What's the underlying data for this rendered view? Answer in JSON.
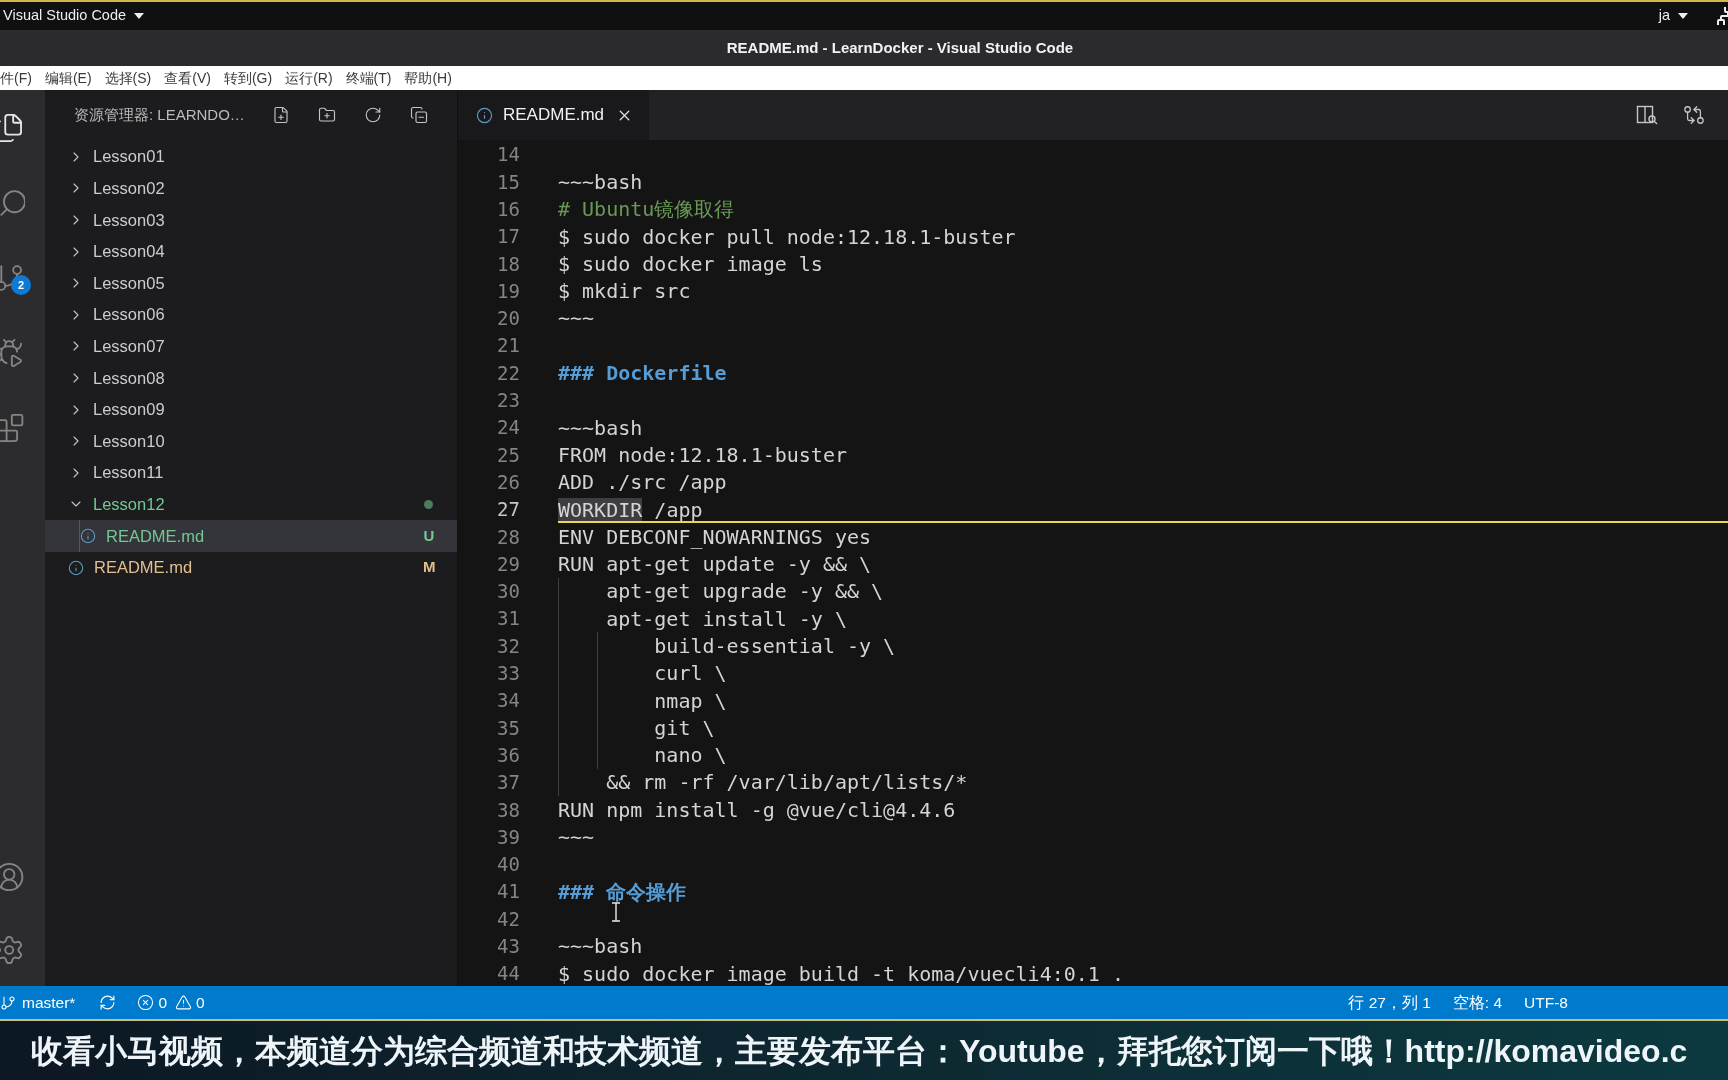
{
  "top_bar": {
    "app_menu": "Visual Studio Code",
    "input_source": "ja"
  },
  "title_bar": {
    "title": "README.md - LearnDocker - Visual Studio Code"
  },
  "menu_bar": {
    "items": [
      "件(F)",
      "编辑(E)",
      "选择(S)",
      "查看(V)",
      "转到(G)",
      "运行(R)",
      "终端(T)",
      "帮助(H)"
    ]
  },
  "activity_bar": {
    "items": [
      {
        "kind": "explorer",
        "selected": true
      },
      {
        "kind": "search",
        "selected": false
      },
      {
        "kind": "source_control",
        "selected": false,
        "badge": "2"
      },
      {
        "kind": "run_debug",
        "selected": false
      },
      {
        "kind": "extensions",
        "selected": false
      }
    ],
    "bottom_items": [
      {
        "kind": "account"
      },
      {
        "kind": "settings"
      }
    ]
  },
  "sidebar": {
    "title": "资源管理器: LEARNDO…",
    "items": [
      {
        "label": "Lesson01",
        "kind": "folder",
        "expanded": false,
        "selected": false
      },
      {
        "label": "Lesson02",
        "kind": "folder",
        "expanded": false,
        "selected": false
      },
      {
        "label": "Lesson03",
        "kind": "folder",
        "expanded": false,
        "selected": false
      },
      {
        "label": "Lesson04",
        "kind": "folder",
        "expanded": false,
        "selected": false
      },
      {
        "label": "Lesson05",
        "kind": "folder",
        "expanded": false,
        "selected": false
      },
      {
        "label": "Lesson06",
        "kind": "folder",
        "expanded": false,
        "selected": false
      },
      {
        "label": "Lesson07",
        "kind": "folder",
        "expanded": false,
        "selected": false
      },
      {
        "label": "Lesson08",
        "kind": "folder",
        "expanded": false,
        "selected": false
      },
      {
        "label": "Lesson09",
        "kind": "folder",
        "expanded": false,
        "selected": false
      },
      {
        "label": "Lesson10",
        "kind": "folder",
        "expanded": false,
        "selected": false
      },
      {
        "label": "Lesson11",
        "kind": "folder",
        "expanded": false,
        "selected": false
      },
      {
        "label": "Lesson12",
        "kind": "folder",
        "expanded": true,
        "selected": false,
        "color": "#73c991",
        "children": [
          {
            "label": "README.md",
            "kind": "file",
            "selected": true,
            "color": "#73c991",
            "badge": "U"
          }
        ]
      },
      {
        "label": "README.md",
        "kind": "file",
        "selected": false,
        "color": "#e2c08d",
        "badge": "M"
      }
    ]
  },
  "editor": {
    "tabs": [
      {
        "label": "README.md",
        "selected": true
      }
    ],
    "lines": [
      {
        "number": "14",
        "current": false
      },
      {
        "number": "15",
        "kind": "code",
        "current": false,
        "tokens": [
          {
            "text": "~~~bash",
            "highlighted": false
          }
        ]
      },
      {
        "number": "16",
        "kind": "comment",
        "current": false,
        "tokens": [
          {
            "text": "# Ubuntu镜像取得",
            "highlighted": false
          }
        ]
      },
      {
        "number": "17",
        "kind": "code",
        "current": false,
        "tokens": [
          {
            "text": "$ sudo docker pull node:12.18.1-buster",
            "highlighted": false
          }
        ]
      },
      {
        "number": "18",
        "kind": "code",
        "current": false,
        "tokens": [
          {
            "text": "$ sudo docker image ls",
            "highlighted": false
          }
        ]
      },
      {
        "number": "19",
        "kind": "code",
        "current": false,
        "tokens": [
          {
            "text": "$ mkdir src",
            "highlighted": false
          }
        ]
      },
      {
        "number": "20",
        "kind": "code",
        "current": false,
        "tokens": [
          {
            "text": "~~~",
            "highlighted": false
          }
        ]
      },
      {
        "number": "21",
        "current": false
      },
      {
        "number": "22",
        "kind": "heading",
        "current": false,
        "tokens": [
          {
            "text": "### Dockerfile",
            "highlighted": false
          }
        ]
      },
      {
        "number": "23",
        "current": false
      },
      {
        "number": "24",
        "kind": "code",
        "current": false,
        "tokens": [
          {
            "text": "~~~bash",
            "highlighted": false
          }
        ]
      },
      {
        "number": "25",
        "kind": "code",
        "current": false,
        "tokens": [
          {
            "text": "FROM node:12.18.1-buster",
            "highlighted": false
          }
        ]
      },
      {
        "number": "26",
        "kind": "code",
        "current": false,
        "tokens": [
          {
            "text": "ADD ./src /app",
            "highlighted": false
          }
        ]
      },
      {
        "number": "27",
        "kind": "code",
        "current": true,
        "tokens": [
          {
            "text": "WORKDIR",
            "highlighted": true
          },
          {
            "text": " /app",
            "highlighted": false
          }
        ]
      },
      {
        "number": "28",
        "kind": "code",
        "current": false,
        "tokens": [
          {
            "text": "ENV DEBCONF_NOWARNINGS yes",
            "highlighted": false
          }
        ]
      },
      {
        "number": "29",
        "kind": "code",
        "current": false,
        "tokens": [
          {
            "text": "RUN apt-get update -y && \\",
            "highlighted": false
          }
        ]
      },
      {
        "number": "30",
        "kind": "code",
        "current": false,
        "tokens": [
          {
            "text": "    apt-get upgrade -y && \\",
            "highlighted": false
          }
        ]
      },
      {
        "number": "31",
        "kind": "code",
        "current": false,
        "tokens": [
          {
            "text": "    apt-get install -y \\",
            "highlighted": false
          }
        ]
      },
      {
        "number": "32",
        "kind": "code",
        "current": false,
        "tokens": [
          {
            "text": "        build-essential -y \\",
            "highlighted": false
          }
        ]
      },
      {
        "number": "33",
        "kind": "code",
        "current": false,
        "tokens": [
          {
            "text": "        curl \\",
            "highlighted": false
          }
        ]
      },
      {
        "number": "34",
        "kind": "code",
        "current": false,
        "tokens": [
          {
            "text": "        nmap \\",
            "highlighted": false
          }
        ]
      },
      {
        "number": "35",
        "kind": "code",
        "current": false,
        "tokens": [
          {
            "text": "        git \\",
            "highlighted": false
          }
        ]
      },
      {
        "number": "36",
        "kind": "code",
        "current": false,
        "tokens": [
          {
            "text": "        nano \\",
            "highlighted": false
          }
        ]
      },
      {
        "number": "37",
        "kind": "code",
        "current": false,
        "tokens": [
          {
            "text": "    && rm -rf /var/lib/apt/lists/*",
            "highlighted": false
          }
        ]
      },
      {
        "number": "38",
        "kind": "code",
        "current": false,
        "tokens": [
          {
            "text": "RUN npm install -g @vue/cli@4.4.6",
            "highlighted": false
          }
        ]
      },
      {
        "number": "39",
        "kind": "code",
        "current": false,
        "tokens": [
          {
            "text": "~~~",
            "highlighted": false
          }
        ]
      },
      {
        "number": "40",
        "current": false
      },
      {
        "number": "41",
        "kind": "heading",
        "current": false,
        "tokens": [
          {
            "text": "### 命令操作",
            "highlighted": false
          }
        ]
      },
      {
        "number": "42",
        "current": false
      },
      {
        "number": "43",
        "kind": "code",
        "current": false,
        "tokens": [
          {
            "text": "~~~bash",
            "highlighted": false
          }
        ]
      },
      {
        "number": "44",
        "kind": "code",
        "current": false,
        "tokens": [
          {
            "text": "$ sudo docker image build -t koma/vuecli4:0.1 .",
            "highlighted": false
          }
        ]
      }
    ]
  },
  "status_bar": {
    "branch": "master*",
    "errors": "0",
    "warnings": "0",
    "position": "行 27，列 1",
    "indentation": "空格: 4",
    "encoding": "UTF-8"
  },
  "caption_banner": {
    "text": "收看小马视频，本频道分为综合频道和技术频道，主要发布平台：Youtube，拜托您订阅一下哦！http://komavideo.c"
  }
}
